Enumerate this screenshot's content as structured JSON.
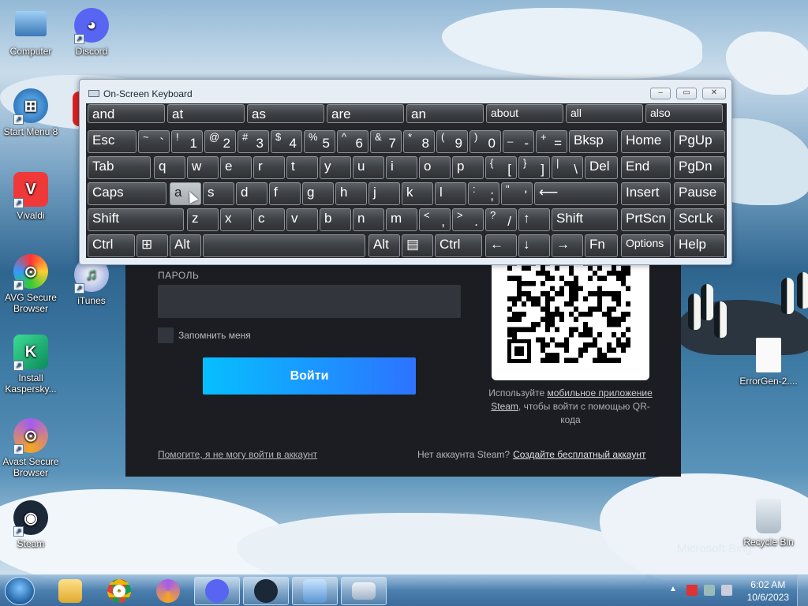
{
  "desktop": {
    "icons": [
      {
        "label": "Computer"
      },
      {
        "label": "Discord"
      },
      {
        "label": "Start Menu 8"
      },
      {
        "label": "Vivaldi"
      },
      {
        "label": "AVG Secure Browser"
      },
      {
        "label": "iTunes"
      },
      {
        "label": "Install Kaspersky..."
      },
      {
        "label": "Avast Secure Browser"
      },
      {
        "label": "Steam"
      },
      {
        "label": "ErrorGen-2...."
      },
      {
        "label": "Recycle Bin"
      }
    ],
    "watermark": "Microsoft Bing"
  },
  "osk": {
    "title": "On-Screen Keyboard",
    "window_buttons": {
      "minimize": "‒",
      "maximize": "▭",
      "close": "✕"
    },
    "predictions": [
      "and",
      "at",
      "as",
      "are",
      "an",
      "about",
      "all",
      "also"
    ],
    "row1": {
      "esc": "Esc",
      "tilde": [
        "~",
        "`"
      ],
      "n1": [
        "!",
        "1"
      ],
      "n2": [
        "@",
        "2"
      ],
      "n3": [
        "#",
        "3"
      ],
      "n4": [
        "$",
        "4"
      ],
      "n5": [
        "%",
        "5"
      ],
      "n6": [
        "^",
        "6"
      ],
      "n7": [
        "&",
        "7"
      ],
      "n8": [
        "*",
        "8"
      ],
      "n9": [
        "(",
        "9"
      ],
      "n0": [
        ")",
        "0"
      ],
      "minus": [
        "_",
        "-"
      ],
      "plus": [
        "+",
        "="
      ],
      "bksp": "Bksp",
      "home": "Home",
      "pgup": "PgUp"
    },
    "row2": {
      "tab": "Tab",
      "q": "q",
      "w": "w",
      "e": "e",
      "r": "r",
      "t": "t",
      "y": "y",
      "u": "u",
      "i": "i",
      "o": "o",
      "p": "p",
      "lbr": [
        "{",
        "["
      ],
      "rbr": [
        "}",
        "]"
      ],
      "bsl": [
        "|",
        "\\"
      ],
      "del": "Del",
      "end": "End",
      "pgdn": "PgDn"
    },
    "row3": {
      "caps": "Caps",
      "a": "a",
      "s": "s",
      "d": "d",
      "f": "f",
      "g": "g",
      "h": "h",
      "j": "j",
      "k": "k",
      "l": "l",
      "semi": [
        ":",
        ";"
      ],
      "quote": [
        "\"",
        "'"
      ],
      "enter": "⟵",
      "insert": "Insert",
      "pause": "Pause"
    },
    "row4": {
      "shift": "Shift",
      "z": "z",
      "x": "x",
      "c": "c",
      "v": "v",
      "b": "b",
      "n": "n",
      "m": "m",
      "comma": [
        "<",
        ","
      ],
      "period": [
        ">",
        "."
      ],
      "slash": [
        "?",
        "/"
      ],
      "up": "↑",
      "rshift": "Shift",
      "prtscn": "PrtScn",
      "scrlk": "ScrLk"
    },
    "row5": {
      "ctrl": "Ctrl",
      "win": "⊞",
      "alt": "Alt",
      "ralt": "Alt",
      "menu": "▤",
      "rctrl": "Ctrl",
      "left": "←",
      "down": "↓",
      "right": "→",
      "fn": "Fn",
      "options": "Options",
      "help": "Help"
    }
  },
  "steam": {
    "password_label": "ПАРОЛЬ",
    "remember_label": "Запомнить меня",
    "login_button": "Войти",
    "qr_text_pre": "Используйте ",
    "qr_link": "мобильное приложение Steam",
    "qr_text_post": ", чтобы войти с помощью QR-кода",
    "help_link": "Помогите, я не могу войти в аккаунт",
    "no_account": "Нет аккаунта Steam?",
    "create_link": "Создайте бесплатный аккаунт"
  },
  "taskbar": {
    "time": "6:02 AM",
    "date": "10/6/2023",
    "tray_arrow": "▲"
  },
  "colors": {
    "steam_blue_start": "#06bfff",
    "steam_blue_end": "#2d73ff",
    "osk_key": "#3f4246"
  }
}
